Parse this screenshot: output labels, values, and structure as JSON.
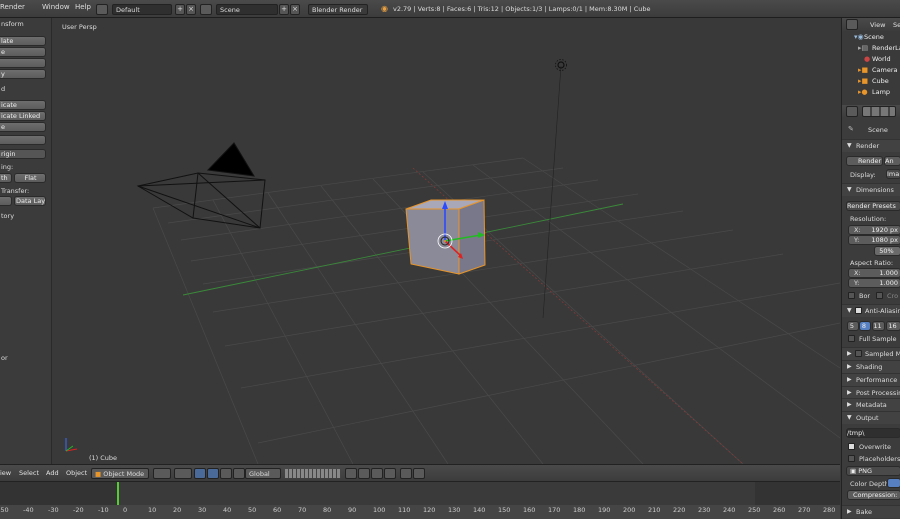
{
  "topbar": {
    "menus": [
      "Render",
      "Window",
      "Help"
    ],
    "layout": "Default",
    "scene": "Scene",
    "engine": "Blender Render",
    "stats": "v2.79 | Verts:8 | Faces:6 | Tris:12 | Objects:1/3 | Lamps:0/1 | Mem:8.30M | Cube"
  },
  "shelf": {
    "buttons": [
      "late",
      "e",
      "y",
      "icate",
      "icate Linked",
      "e",
      "rigin"
    ],
    "labels": [
      "nsform",
      "ing:",
      "Transfer:",
      "tory",
      "or"
    ],
    "shading": [
      "th",
      "Flat"
    ],
    "datalayout": "Data Layo"
  },
  "viewport": {
    "view_name": "User Persp",
    "object_label": "(1) Cube"
  },
  "header": {
    "menus": [
      "iew",
      "Select",
      "Add",
      "Object"
    ],
    "mode": "Object Mode",
    "pivot": "Global"
  },
  "timeline": {
    "ticks": [
      "-50",
      "-40",
      "-30",
      "-20",
      "-10",
      "0",
      "10",
      "20",
      "30",
      "40",
      "50",
      "60",
      "70",
      "80",
      "90",
      "100",
      "110",
      "120",
      "130",
      "140",
      "150",
      "160",
      "170",
      "180",
      "190",
      "200",
      "210",
      "220",
      "230",
      "240",
      "250",
      "260",
      "270",
      "280"
    ]
  },
  "outliner": {
    "tabs": [
      "View",
      "Se"
    ],
    "items": [
      "Scene",
      "RenderLa",
      "World",
      "Camera",
      "Cube",
      "Lamp"
    ]
  },
  "properties": {
    "context": "Scene",
    "render_panel": "Render",
    "render_btn": "Render",
    "anim_btn": "An",
    "display_label": "Display:",
    "display_value": "Ima",
    "dimensions": "Dimensions",
    "presets": "Render Presets",
    "resolution": "Resolution:",
    "res_x": "X:",
    "res_x_val": "1920 px",
    "res_y": "Y:",
    "res_y_val": "1080 px",
    "res_pct": "50%",
    "aspect": "Aspect Ratio:",
    "asp_x": "X:",
    "asp_x_val": "1.000",
    "asp_y": "Y:",
    "asp_y_val": "1.000",
    "bor": "Bor",
    "cro": "Cro",
    "aa": "Anti-Aliasing",
    "aa_samples": [
      "5",
      "8",
      "11",
      "16"
    ],
    "full_sample": "Full Sample",
    "sampled": "Sampled Mo",
    "shading": "Shading",
    "performance": "Performance",
    "post": "Post Processing",
    "metadata": "Metadata",
    "output": "Output",
    "output_path": "/tmp\\",
    "overwrite": "Overwrite",
    "placeholders": "Placeholders",
    "format": "PNG",
    "color_depth": "Color Depth:",
    "compression": "Compression:",
    "bake": "Bake"
  }
}
